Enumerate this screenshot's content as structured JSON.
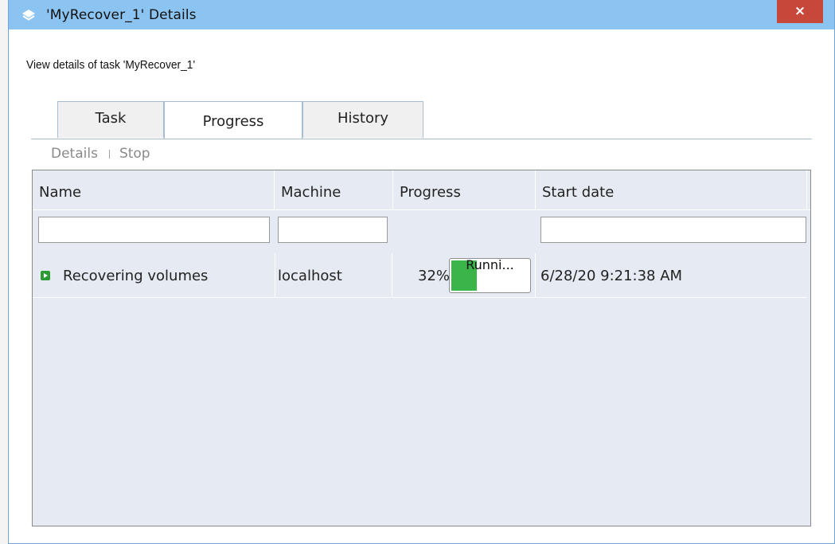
{
  "window": {
    "title": "'MyRecover_1' Details",
    "close_label": "×"
  },
  "subtitle": "View details of task 'MyRecover_1'",
  "tabs": [
    {
      "label": "Task"
    },
    {
      "label": "Progress",
      "active": true
    },
    {
      "label": "History"
    }
  ],
  "toolbar": {
    "details_label": "Details",
    "stop_label": "Stop"
  },
  "table": {
    "columns": [
      "Name",
      "Machine",
      "Progress",
      "Start date"
    ],
    "rows": [
      {
        "name": "Recovering volumes",
        "machine": "localhost",
        "progress_percent": "32%",
        "progress_value": 0.32,
        "progress_status": "Runni...",
        "start_date": "6/28/20 9:21:38 AM"
      }
    ]
  },
  "colors": {
    "titlebar": "#8cc4f1",
    "close": "#c7473b",
    "progress_fill": "#3bb54a",
    "grid_bg": "#e6ebf3"
  },
  "icons": {
    "title": "layers-icon",
    "row_status": "play-icon"
  }
}
